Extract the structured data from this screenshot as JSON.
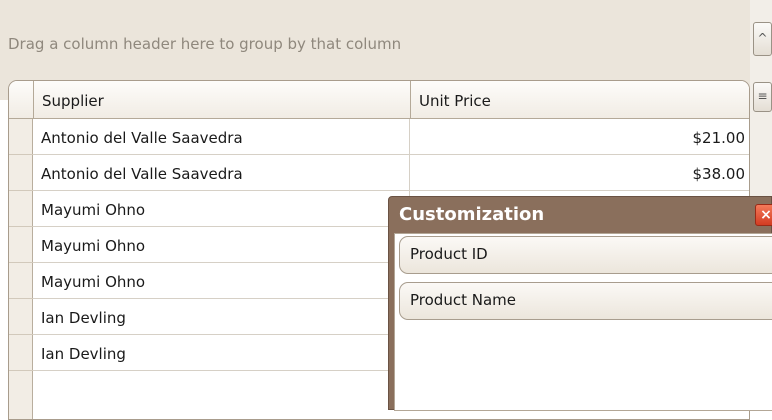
{
  "group_panel": {
    "hint": "Drag a column header here to group by that column"
  },
  "columns": {
    "supplier": "Supplier",
    "unit_price": "Unit Price"
  },
  "rows": [
    {
      "supplier": "Antonio del Valle Saavedra",
      "unit_price": "$21.00"
    },
    {
      "supplier": "Antonio del Valle Saavedra",
      "unit_price": "$38.00"
    },
    {
      "supplier": "Mayumi Ohno",
      "unit_price": ""
    },
    {
      "supplier": "Mayumi Ohno",
      "unit_price": ""
    },
    {
      "supplier": "Mayumi Ohno",
      "unit_price": ""
    },
    {
      "supplier": "Ian Devling",
      "unit_price": ""
    },
    {
      "supplier": "Ian Devling",
      "unit_price": ""
    }
  ],
  "customization": {
    "title": "Customization",
    "close_glyph": "×",
    "items": [
      "Product ID",
      "Product Name"
    ]
  },
  "scrollbar": {
    "up_glyph": "^",
    "menu_glyph": "≡"
  }
}
